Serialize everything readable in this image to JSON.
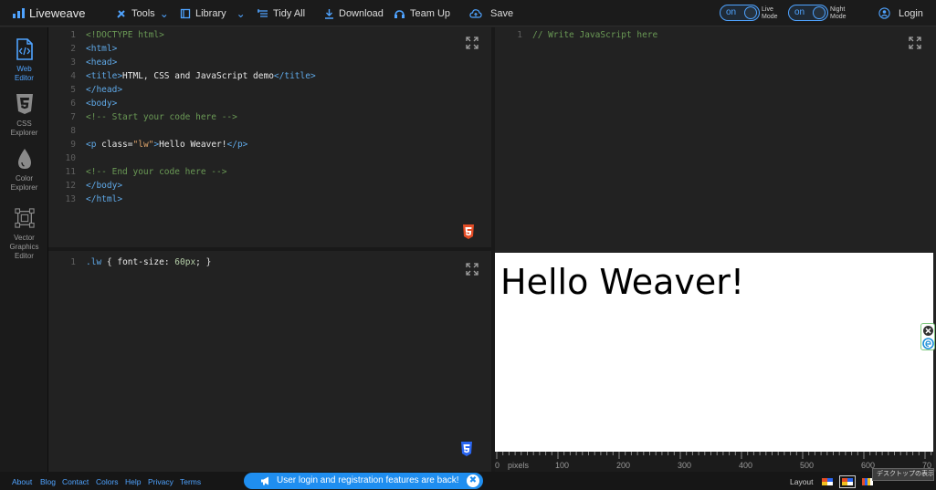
{
  "app": {
    "name": "Liveweave",
    "accent": "#4fa3ff"
  },
  "toolbar": {
    "tools_label": "Tools",
    "library_label": "Library",
    "tidy_label": "Tidy All",
    "download_label": "Download",
    "teamup_label": "Team Up",
    "save_label": "Save",
    "live_mode": {
      "state": "on",
      "label_line1": "Live",
      "label_line2": "Mode"
    },
    "night_mode": {
      "state": "on",
      "label_line1": "Night",
      "label_line2": "Mode"
    },
    "login_label": "Login"
  },
  "sidebar": {
    "items": [
      {
        "line1": "Web",
        "line2": "Editor",
        "line3": "",
        "icon": "code-file-icon",
        "active": true
      },
      {
        "line1": "CSS",
        "line2": "Explorer",
        "line3": "",
        "icon": "css3-icon",
        "active": false
      },
      {
        "line1": "Color",
        "line2": "Explorer",
        "line3": "",
        "icon": "droplet-icon",
        "active": false
      },
      {
        "line1": "Vector",
        "line2": "Graphics",
        "line3": "Editor",
        "icon": "vector-icon",
        "active": false
      }
    ]
  },
  "html_editor": {
    "line_numbers": [
      "1",
      "2",
      "3",
      "4",
      "5",
      "6",
      "7",
      "8",
      "9",
      "10",
      "11",
      "12",
      "13"
    ],
    "lines": [
      {
        "type": "doctype",
        "text": "<!DOCTYPE html>"
      },
      {
        "type": "tag",
        "text": "<html>"
      },
      {
        "type": "tag",
        "text": "<head>"
      },
      {
        "type": "title",
        "open": "<title>",
        "content": "HTML, CSS and JavaScript demo",
        "close": "</title>"
      },
      {
        "type": "tag",
        "text": "</head>"
      },
      {
        "type": "tag",
        "text": "<body>"
      },
      {
        "type": "comment",
        "text": "<!-- Start your code here -->"
      },
      {
        "type": "blank",
        "text": ""
      },
      {
        "type": "p",
        "open": "<p ",
        "attr": "class",
        "eq": "=",
        "val": "\"lw\"",
        "gt": ">",
        "content": "Hello Weaver!",
        "close": "</p>"
      },
      {
        "type": "blank",
        "text": ""
      },
      {
        "type": "comment",
        "text": "<!-- End your code here -->"
      },
      {
        "type": "tag",
        "text": "</body>"
      },
      {
        "type": "tag",
        "text": "</html>"
      }
    ]
  },
  "css_editor": {
    "line_numbers": [
      "1"
    ],
    "selector": ".lw",
    "open_brace": " { ",
    "property": "font-size",
    "colon": ": ",
    "value": "60px",
    "close": "; }"
  },
  "js_editor": {
    "line_numbers": [
      "1"
    ],
    "comment": "// Write JavaScript here"
  },
  "preview": {
    "text": "Hello Weaver!",
    "background": "#ffffff"
  },
  "ruler": {
    "unit_label": "pixels",
    "zero": "0",
    "labels": [
      "100",
      "200",
      "300",
      "400",
      "500",
      "600",
      "70"
    ]
  },
  "footer": {
    "links": [
      "About",
      "Blog",
      "Contact",
      "Colors",
      "Help",
      "Privacy",
      "Terms"
    ],
    "announcement": "User login and registration features are back!",
    "layout_label": "Layout",
    "tooltip": "デスクトップの表示"
  }
}
